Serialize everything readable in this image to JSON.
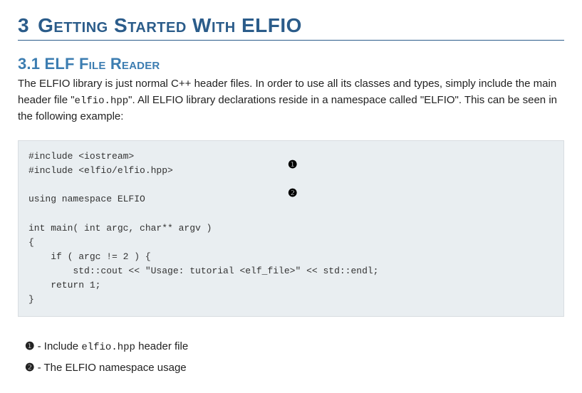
{
  "chapter": {
    "number": "3",
    "title": "Getting Started With ELFIO"
  },
  "section": {
    "number": "3.1",
    "title": "ELF File Reader"
  },
  "intro_parts": {
    "p1": "The ELFIO library is just normal C++ header files. In order to use all its classes and types, simply include the main header file \"",
    "code1": "elfio.hpp",
    "p2": "\". All ELFIO library declarations reside in a namespace called \"ELFIO\". This can be seen in the following example:"
  },
  "code": "#include <iostream>\n#include <elfio/elfio.hpp>\n\nusing namespace ELFIO\n\nint main( int argc, char** argv )\n{\n    if ( argc != 2 ) {\n        std::cout << \"Usage: tutorial <elf_file>\" << std::endl;\n    return 1;\n}",
  "callouts": {
    "one": "❶",
    "two": "❷"
  },
  "legend": {
    "row1": {
      "num": "❶",
      "dash": " - Include ",
      "code": "elfio.hpp",
      "tail": " header file"
    },
    "row2": {
      "num": "❷",
      "dash": " - The ELFIO namespace usage"
    }
  }
}
